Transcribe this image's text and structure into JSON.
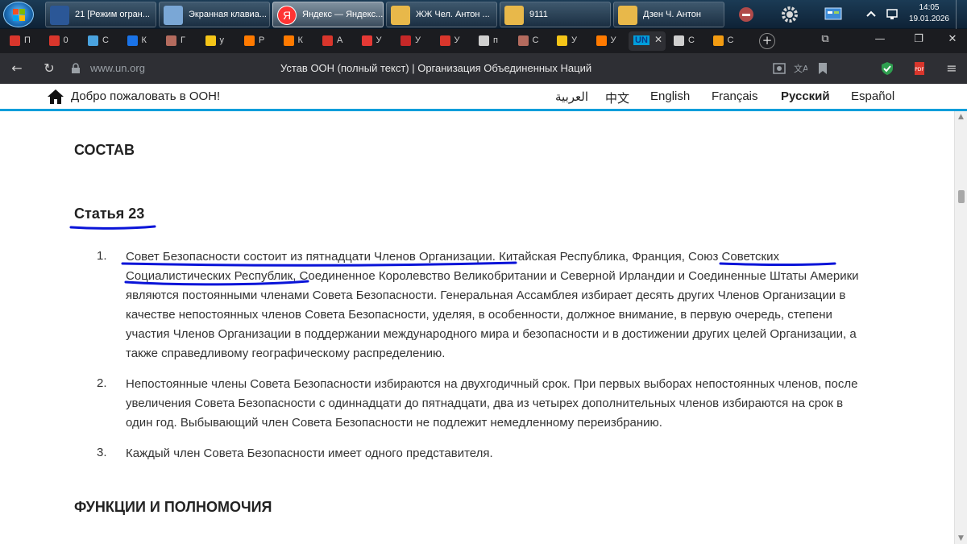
{
  "taskbar": {
    "tasks": [
      {
        "label": "21 [Режим огран...",
        "icon": "word-icon",
        "color": "#2b5797"
      },
      {
        "label": "Экранная клавиа...",
        "icon": "keyboard-icon",
        "color": "#7aa7d6"
      },
      {
        "label": "Яндекс — Яндекс...",
        "icon": "yandex-browser-icon",
        "color": "#ff3333"
      },
      {
        "label": "ЖЖ Чел. Антон ...",
        "icon": "folder-icon",
        "color": "#e8b84a"
      },
      {
        "label": "9111",
        "icon": "folder-icon",
        "color": "#e8b84a"
      },
      {
        "label": "Дзен Ч. Антон",
        "icon": "folder-icon",
        "color": "#e8b84a"
      }
    ],
    "clock": {
      "time": "14:05",
      "date": "19.01.2026"
    }
  },
  "tabs": [
    {
      "label": "П",
      "color": "#d9362c"
    },
    {
      "label": "0",
      "color": "#d9362c"
    },
    {
      "label": "С",
      "color": "#4aa3df"
    },
    {
      "label": "К",
      "color": "#1a73e8"
    },
    {
      "label": "Г",
      "color": "#b46b5e"
    },
    {
      "label": "у",
      "color": "#f5c518"
    },
    {
      "label": "Р",
      "color": "#ff7a00"
    },
    {
      "label": "К",
      "color": "#ff7a00"
    },
    {
      "label": "А",
      "color": "#d9362c"
    },
    {
      "label": "У",
      "color": "#e53935"
    },
    {
      "label": "У",
      "color": "#c62828"
    },
    {
      "label": "У",
      "color": "#d9362c"
    },
    {
      "label": "п",
      "color": "#cfcfcf"
    },
    {
      "label": "С",
      "color": "#b46b5e"
    },
    {
      "label": "У",
      "color": "#f5c518"
    },
    {
      "label": "У",
      "color": "#ff7a00"
    },
    {
      "label": "UN",
      "color": "#009edb",
      "active": true
    },
    {
      "label": "С",
      "color": "#cfcfcf"
    },
    {
      "label": "С",
      "color": "#f39c12"
    }
  ],
  "addressbar": {
    "host": "www.un.org",
    "title": "Устав ООН (полный текст) | Организация Объединенных Наций"
  },
  "site_nav": {
    "welcome": "Добро пожаловать в ООН!",
    "languages": [
      "العربية",
      "中文",
      "English",
      "Français",
      "Русский",
      "Español"
    ],
    "selected": "Русский"
  },
  "content": {
    "section1": "СОСТАВ",
    "article": "Статья 23",
    "items": [
      {
        "num": "1.",
        "text": "Совет Безопасности состоит из пятнадцати Членов Организации. Китайская Республика, Франция, Союз Советских Социалистических Республик, Соединенное Королевство Великобритании и Северной Ирландии и Соединенные Штаты Америки являются постоянными членами Совета Безопасности. Генеральная Ассамблея избирает десять других Членов Организации в качестве непостоянных членов Совета Безопасности, уделяя, в особенности, должное внимание, в первую очередь, степени участия Членов Организации в поддержании международного мира и безопасности и в достижении других целей Организации, а также справедливому географическому распределению."
      },
      {
        "num": "2.",
        "text": "Непостоянные члены Совета Безопасности избираются на двухгодичный срок. При первых выборах непостоянных членов, после увеличения Совета Безопасности с одиннадцати до пятнадцати, два из четырех дополнительных членов избираются на срок в один год. Выбывающий член Совета Безопасности не подлежит немедленному переизбранию."
      },
      {
        "num": "3.",
        "text": "Каждый член Совета Безопасности имеет одного представителя."
      }
    ],
    "section2": "ФУНКЦИИ И ПОЛНОМОЧИЯ"
  },
  "colors": {
    "un_blue": "#009edb",
    "ink_blue": "#0a14d8",
    "taskbar": "#1b3b55",
    "browser_dark": "#2e2f34"
  }
}
